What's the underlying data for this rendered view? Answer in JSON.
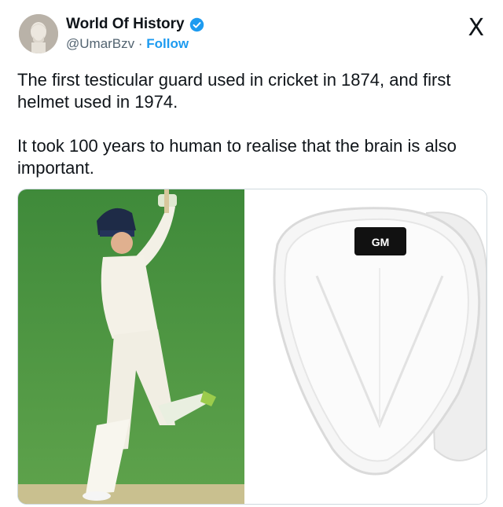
{
  "author": {
    "display_name": "World Of History",
    "handle": "@UmarBzv",
    "separator": " · ",
    "follow_label": "Follow",
    "verified": true
  },
  "brand": {
    "logo": "X"
  },
  "tweet": {
    "paragraph1": "The first testicular guard used in cricket in 1874, and first helmet used in 1974.",
    "paragraph2": "It took 100 years to human to realise that the brain is also important."
  },
  "media": {
    "guard_brand": "GM"
  },
  "colors": {
    "link": "#1d9bf0",
    "text": "#0f1419",
    "secondary": "#536471"
  }
}
